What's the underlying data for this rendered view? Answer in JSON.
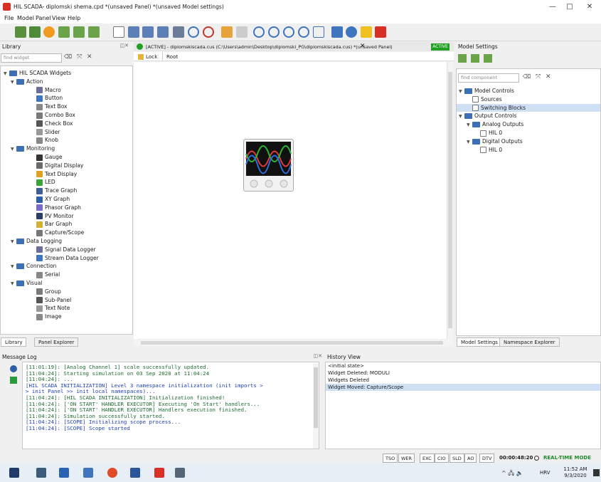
{
  "window": {
    "title": "HIL SCADA- diplomski shema.cpd  *(unsaved Panel) *(unsaved Model settings)",
    "min": "—",
    "max": "□",
    "close": "✕"
  },
  "menu": [
    "File",
    "Model",
    "Panel",
    "View",
    "Help"
  ],
  "library": {
    "header": "Library",
    "search_placeholder": "find widget",
    "root": "HIL SCADA Widgets",
    "groups": [
      {
        "label": "Action",
        "items": [
          "Macro",
          "Button",
          "Text Box",
          "Combo Box",
          "Check Box",
          "Slider",
          "Knob"
        ]
      },
      {
        "label": "Monitoring",
        "items": [
          "Gauge",
          "Digital Display",
          "Text Display",
          "LED",
          "Trace Graph",
          "XY Graph",
          "Phasor Graph",
          "PV Monitor",
          "Bar Graph",
          "Capture/Scope"
        ]
      },
      {
        "label": "Data Logging",
        "items": [
          "Signal Data Logger",
          "Stream Data Logger"
        ]
      },
      {
        "label": "Connection",
        "items": [
          "Serial"
        ]
      },
      {
        "label": "Visual",
        "items": [
          "Group",
          "Sub-Panel",
          "Text Note",
          "Image"
        ]
      }
    ],
    "tabs": [
      "Library",
      "Panel Explorer"
    ]
  },
  "canvas": {
    "tab_title": "[ACTIVE] - diplomskiscada.cus (C:\\Users\\admin\\Desktop\\diplomski_PG\\diplomskiscada.cus) *(unsaved Panel)",
    "tab_close": "✕",
    "active_badge": "ACTIVE",
    "lock_label": "Lock",
    "root_label": "Root"
  },
  "model_settings": {
    "header": "Model Settings",
    "search_placeholder": "find component",
    "tree": [
      {
        "label": "Model Controls",
        "level": 0,
        "folder": true
      },
      {
        "label": "Sources",
        "level": 1,
        "folder": false
      },
      {
        "label": "Switching Blocks",
        "level": 1,
        "folder": false,
        "selected": true
      },
      {
        "label": "Output Controls",
        "level": 0,
        "folder": true
      },
      {
        "label": "Analog Outputs",
        "level": 1,
        "folder": true
      },
      {
        "label": "HIL 0",
        "level": 2,
        "folder": false
      },
      {
        "label": "Digital Outputs",
        "level": 1,
        "folder": true
      },
      {
        "label": "HIL 0",
        "level": 2,
        "folder": false
      }
    ],
    "tabs": [
      "Model Settings",
      "Namespace Explorer"
    ]
  },
  "message_log": {
    "header": "Message Log",
    "lines": [
      {
        "text": "[11:01:19]: [Analog Channel 1] scale successfully updated.",
        "c": "g"
      },
      {
        "text": "[11:04:24]: Starting simulation on 03 Sep 2020 at 11:04:24",
        "c": "g"
      },
      {
        "text": "[11:04:24]: ...",
        "c": "g"
      },
      {
        "text": "[HIL SCADA INITIALIZATION] Level 3 namespace initialization (init imports >",
        "c": "b"
      },
      {
        "text": "> init Panel >> init local namespaces)...",
        "c": "b"
      },
      {
        "text": "[11:04:24]: [HIL SCADA INITIALIZATION] Initialization finished!",
        "c": "g"
      },
      {
        "text": "[11:04:24]: ['ON START' HANDLER EXECUTOR] Executing 'On Start' handlers...",
        "c": "g"
      },
      {
        "text": "[11:04:24]: ['ON START' HANDLER EXECUTOR] Handlers execution finished.",
        "c": "g"
      },
      {
        "text": "[11:04:24]: Simulation successfully started.",
        "c": "g"
      },
      {
        "text": "[11:04:24]: [SCOPE] Initializing scope process...",
        "c": "b"
      },
      {
        "text": "[11:04:24]: [SCOPE] Scope started",
        "c": "b"
      }
    ]
  },
  "history": {
    "header": "History View",
    "items": [
      "<initial state>",
      "Widget Deleted: MODULI",
      "Widgets Deleted",
      "Widget Moved: Capture/Scope"
    ],
    "selected_index": 3
  },
  "status": {
    "boxes1": [
      "TSO",
      "WER"
    ],
    "boxes2": [
      "EXC",
      "CIO",
      "SLD",
      "AO",
      "DTV"
    ],
    "time": "00:00:48:20",
    "mode": "REAL-TIME MODE"
  },
  "taskbar": {
    "lang": "HRV",
    "time": "11:52 AM",
    "date": "9/3/2020",
    "tray": "^ 🖧 🔈"
  },
  "colors": {
    "accent": "#d93025",
    "active_green": "#23a023",
    "selection": "#cfe0f5"
  }
}
